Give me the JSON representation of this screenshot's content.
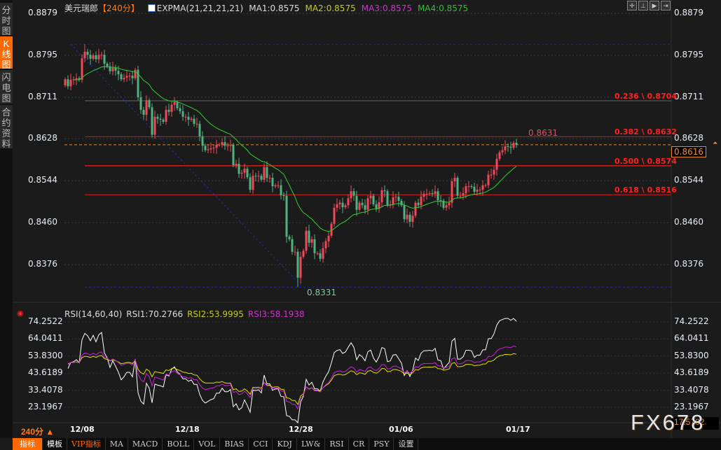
{
  "sidebar": {
    "items": [
      {
        "label": "分时图"
      },
      {
        "label": "K线图",
        "active": true
      },
      {
        "label": "闪电图"
      },
      {
        "label": "合约资料"
      }
    ]
  },
  "header": {
    "symbol": "美元瑞郎",
    "period": "【240分】",
    "indicator": "EXPMA(21,21,21,21)",
    "ma1": "MA1:0.8575",
    "ma2": "MA2:0.8575",
    "ma3": "MA3:0.8575",
    "ma4": "MA4:0.8575"
  },
  "toolbar_icons": [
    "crosshair-icon",
    "zoom-axis-icon",
    "play-axis-icon",
    "shift-right-icon"
  ],
  "price_axis": {
    "labels": [
      "0.8879",
      "0.8795",
      "0.8711",
      "0.8628",
      "0.8544",
      "0.8460",
      "0.8376"
    ],
    "current": "0.8616"
  },
  "annotations": {
    "high": "0.8631",
    "low": "0.8331"
  },
  "fib": [
    {
      "label": "0.236 \\ 0.8704",
      "price": 0.8704
    },
    {
      "label": "0.382 \\ 0.8632",
      "price": 0.8632
    },
    {
      "label": "0.500 \\ 0.8574",
      "price": 0.8574
    },
    {
      "label": "0.618 \\ 0.8516",
      "price": 0.8516
    }
  ],
  "rsi": {
    "title": "RSI(14,60,40)",
    "rsi1": "RSI1:70.2766",
    "rsi2": "RSI2:53.9995",
    "rsi3": "RSI3:58.1938",
    "labels": [
      "74.2522",
      "64.0411",
      "53.8300",
      "43.6189",
      "33.4078",
      "23.1967"
    ],
    "current": "17.5702"
  },
  "xaxis": {
    "period": "240分 ▲",
    "dates": [
      "12/08",
      "12/18",
      "12/28",
      "01/06",
      "01/17"
    ]
  },
  "watermark": "FX678",
  "bottom_tabs": [
    "指标",
    "模板",
    "VIP指标",
    "MA",
    "MACD",
    "BOLL",
    "VOL",
    "BIAS",
    "CCI",
    "KDJ",
    "LW&",
    "RSI",
    "CR",
    "PSY",
    "设置"
  ],
  "colors": {
    "up": "#f0485a",
    "down": "#4fb380",
    "expma": "#30d030",
    "rsi1": "#ffffff",
    "rsi2": "#e0e000",
    "rsi3": "#d020e0",
    "accent": "#ff6a00"
  },
  "chart_data": {
    "type": "candlestick",
    "title": "美元瑞郎 240分",
    "ylim": [
      0.83,
      0.889
    ],
    "closes": [
      0.8747,
      0.8733,
      0.8746,
      0.8747,
      0.8749,
      0.8746,
      0.8789,
      0.8802,
      0.8796,
      0.8788,
      0.8795,
      0.8787,
      0.8796,
      0.8796,
      0.8778,
      0.8773,
      0.8763,
      0.877,
      0.8764,
      0.8757,
      0.8747,
      0.875,
      0.8754,
      0.8754,
      0.8749,
      0.8766,
      0.8711,
      0.8686,
      0.8676,
      0.8705,
      0.8691,
      0.8636,
      0.8672,
      0.8668,
      0.8666,
      0.8662,
      0.8686,
      0.8682,
      0.8696,
      0.8701,
      0.8689,
      0.8683,
      0.8672,
      0.8672,
      0.8666,
      0.8668,
      0.8658,
      0.8658,
      0.8633,
      0.8614,
      0.8605,
      0.8607,
      0.8609,
      0.861,
      0.8616,
      0.8616,
      0.8621,
      0.8614,
      0.8614,
      0.8616,
      0.8575,
      0.8578,
      0.8558,
      0.856,
      0.8568,
      0.8551,
      0.8526,
      0.8554,
      0.8553,
      0.8554,
      0.8546,
      0.8571,
      0.855,
      0.855,
      0.8533,
      0.8535,
      0.8535,
      0.8515,
      0.8514,
      0.8432,
      0.8427,
      0.8402,
      0.8402,
      0.835,
      0.8392,
      0.8404,
      0.8444,
      0.842,
      0.8427,
      0.8399,
      0.8399,
      0.8388,
      0.8409,
      0.8423,
      0.8434,
      0.8458,
      0.849,
      0.8497,
      0.85,
      0.8491,
      0.8495,
      0.8509,
      0.8523,
      0.8514,
      0.8486,
      0.85,
      0.8495,
      0.8486,
      0.8509,
      0.8514,
      0.8497,
      0.8488,
      0.8501,
      0.8525,
      0.8523,
      0.8495,
      0.8497,
      0.8511,
      0.8512,
      0.8504,
      0.8495,
      0.8467,
      0.8476,
      0.8462,
      0.8474,
      0.85,
      0.8495,
      0.8512,
      0.8518,
      0.8518,
      0.8519,
      0.8518,
      0.8523,
      0.8505,
      0.8504,
      0.849,
      0.8495,
      0.85,
      0.8543,
      0.855,
      0.8514,
      0.8514,
      0.8519,
      0.8533,
      0.8533,
      0.8532,
      0.8522,
      0.8526,
      0.8526,
      0.8535,
      0.8535,
      0.8556,
      0.8556,
      0.8566,
      0.8588,
      0.8601,
      0.8605,
      0.8613,
      0.8612,
      0.861,
      0.862,
      0.8616
    ],
    "first_open": 0.8735,
    "max_high": 0.8817,
    "min_low": 0.8331,
    "rsi_ylim": [
      17.5702,
      74.2522
    ]
  }
}
